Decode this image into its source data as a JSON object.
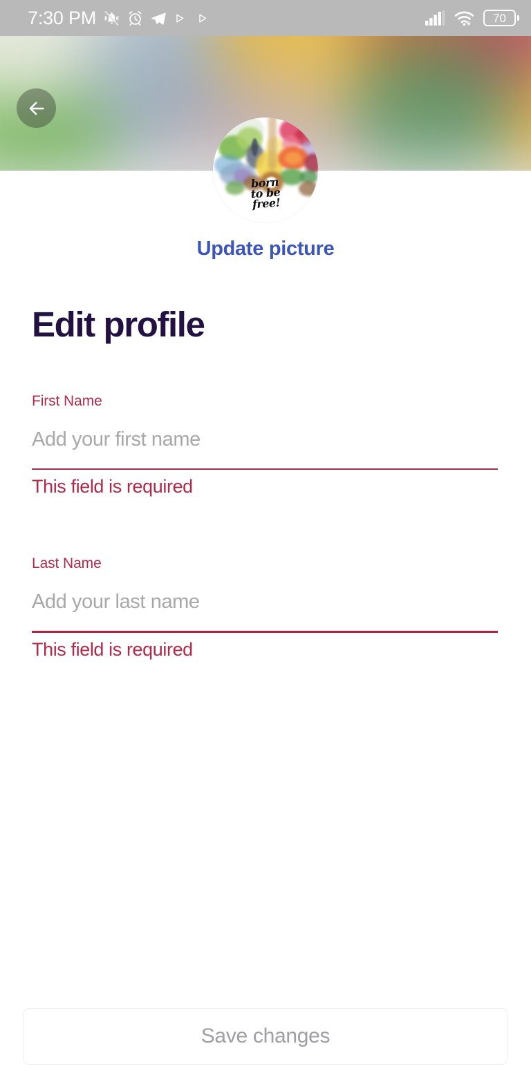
{
  "status_bar": {
    "time": "7:30 PM",
    "battery_level": "70",
    "left_icons": [
      "silent-bell-icon",
      "alarm-clock-icon",
      "telegram-icon",
      "play-triangle-icon",
      "play-triangle-icon"
    ],
    "right_icons": [
      "signal-bars-icon",
      "wifi-icon",
      "battery-icon"
    ],
    "background_color": "#b9b9b9",
    "foreground_color": "#fdfdfd"
  },
  "header": {
    "back_icon": "arrow-left-icon",
    "banner_type": "blurred-profile-image",
    "banner_colors": [
      "#8fc270",
      "#a9b9c4",
      "#e0b040",
      "#c96f4f",
      "#b05360",
      "#4f8f62",
      "#d8c0b0"
    ]
  },
  "avatar": {
    "alt": "watercolor illustration with handwritten text",
    "caption_line1": "born",
    "caption_line2": "to be",
    "caption_line3": "free!"
  },
  "update_picture": {
    "label": "Update picture",
    "color": "#3c55b8"
  },
  "page": {
    "title": "Edit profile",
    "title_color": "#231142"
  },
  "form": {
    "error_color": "#b22a4a",
    "fields": [
      {
        "id": "first-name",
        "label": "First Name",
        "placeholder": "Add your first name",
        "value": "",
        "error": "This field is required",
        "underline_color": "#a0304e"
      },
      {
        "id": "last-name",
        "label": "Last Name",
        "placeholder": "Add your last name",
        "value": "",
        "error": "This field is required",
        "underline_color": "#b42040"
      }
    ]
  },
  "footer": {
    "save_label": "Save changes",
    "save_enabled": false,
    "save_text_color": "#9e9ea6"
  }
}
